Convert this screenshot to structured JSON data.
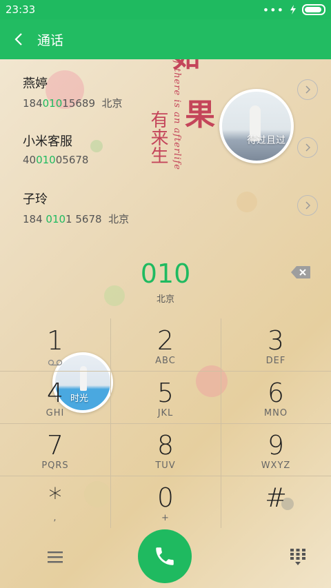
{
  "status_bar": {
    "time": "23:33",
    "icons": [
      "more-dots-icon",
      "charging-bolt-icon",
      "battery-icon"
    ]
  },
  "header": {
    "title": "通话",
    "back_icon": "back-chevron-icon"
  },
  "contacts": [
    {
      "name": "燕婷",
      "number_prefix": "184",
      "number_match": "010",
      "number_suffix": "15689",
      "location": "北京"
    },
    {
      "name": "小米客服",
      "number_prefix": "40",
      "number_match": "010",
      "number_suffix": "05678",
      "location": ""
    },
    {
      "name": "子玲",
      "number_prefix": "184 ",
      "number_match": "010",
      "number_suffix": "1 5678",
      "location": "北京"
    }
  ],
  "decor": {
    "char_fruit": "果",
    "vertical_cn": "有来生",
    "vertical_en": "f there is an afterlife",
    "photo1_caption": "得过且过",
    "photo2_caption": "时光"
  },
  "dial": {
    "entered": "010",
    "location": "北京"
  },
  "keypad": [
    {
      "digit": "1",
      "letters": "",
      "icon": "voicemail-icon"
    },
    {
      "digit": "2",
      "letters": "ABC"
    },
    {
      "digit": "3",
      "letters": "DEF"
    },
    {
      "digit": "4",
      "letters": "GHI"
    },
    {
      "digit": "5",
      "letters": "JKL"
    },
    {
      "digit": "6",
      "letters": "MNO"
    },
    {
      "digit": "7",
      "letters": "PQRS"
    },
    {
      "digit": "8",
      "letters": "TUV"
    },
    {
      "digit": "9",
      "letters": "WXYZ"
    },
    {
      "digit": "*",
      "letters": ","
    },
    {
      "digit": "0",
      "letters": "+"
    },
    {
      "digit": "#",
      "letters": ""
    }
  ],
  "bottom_bar": {
    "menu_icon": "menu-icon",
    "call_icon": "phone-icon",
    "keypad_toggle_icon": "dialpad-icon"
  },
  "colors": {
    "accent": "#1fba60",
    "deco_red": "#c4455a"
  }
}
